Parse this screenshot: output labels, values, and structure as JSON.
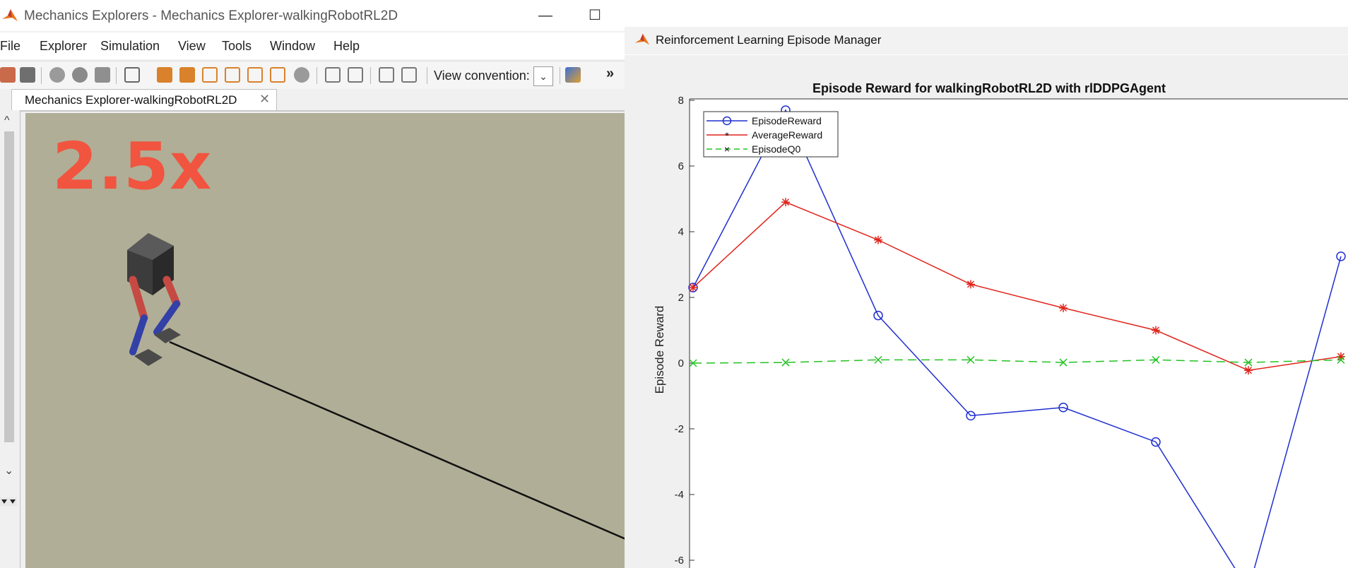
{
  "left_window": {
    "title": "Mechanics Explorers - Mechanics Explorer-walkingRobotRL2D",
    "menu": [
      "File",
      "Explorer",
      "Simulation",
      "View",
      "Tools",
      "Window",
      "Help"
    ],
    "toolbar": {
      "view_convention_label": "View convention:",
      "more_label": "»"
    },
    "tab_label": "Mechanics Explorer-walkingRobotRL2D",
    "speed_badge": "2.5x"
  },
  "right_window": {
    "title": "Reinforcement Learning Episode Manager"
  },
  "colors": {
    "episode_reward": "#1f2fd0",
    "average_reward": "#e0241c",
    "episode_q0": "#22c222",
    "viewport_bg": "#b0ae96",
    "speed_badge": "#f1543f"
  },
  "chart_data": {
    "type": "line",
    "title": "Episode Reward for walkingRobotRL2D with rlDDPGAgent",
    "xlabel": "",
    "ylabel": "Episode Reward",
    "ylim": [
      -6,
      8
    ],
    "yticks": [
      -6,
      -4,
      -2,
      0,
      2,
      4,
      6,
      8
    ],
    "x": [
      1,
      2,
      3,
      4,
      5,
      6,
      7,
      8
    ],
    "legend_position": "top-left",
    "grid": false,
    "series": [
      {
        "name": "EpisodeReward",
        "marker": "circle",
        "line": "solid",
        "color": "#1f2fd0",
        "values": [
          2.3,
          7.7,
          1.45,
          -1.6,
          -1.35,
          -2.4,
          -6.9,
          3.25
        ]
      },
      {
        "name": "AverageReward",
        "marker": "star",
        "line": "solid",
        "color": "#e0241c",
        "values": [
          2.3,
          4.9,
          3.75,
          2.4,
          1.68,
          1.0,
          -0.22,
          0.2
        ]
      },
      {
        "name": "EpisodeQ0",
        "marker": "x",
        "line": "dashed",
        "color": "#22c222",
        "values": [
          0.0,
          0.02,
          0.1,
          0.1,
          0.02,
          0.1,
          0.02,
          0.1
        ]
      }
    ]
  }
}
